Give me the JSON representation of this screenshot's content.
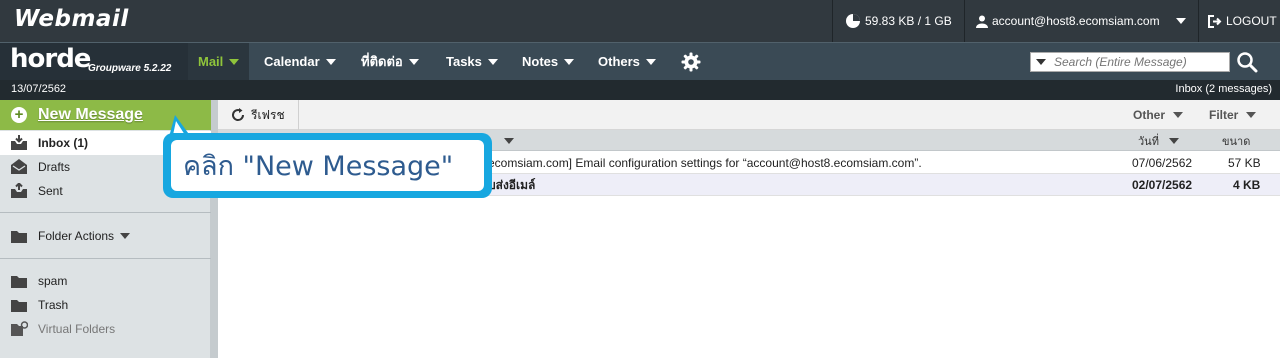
{
  "topbar": {
    "brand": "Webmail",
    "quota": "59.83 KB / 1 GB",
    "account": "account@host8.ecomsiam.com",
    "logout": "LOGOUT"
  },
  "nav": {
    "logo": "horde",
    "version": "Groupware 5.2.22",
    "items": [
      {
        "label": "Mail"
      },
      {
        "label": "Calendar"
      },
      {
        "label": "ที่ติดต่อ"
      },
      {
        "label": "Tasks"
      },
      {
        "label": "Notes"
      },
      {
        "label": "Others"
      }
    ],
    "search_placeholder": "Search (Entire Message)"
  },
  "infobar": {
    "date": "13/07/2562",
    "mailbox_status": "Inbox (2 messages)"
  },
  "sidebar": {
    "new_message": "New Message",
    "folders": [
      {
        "label": "Inbox (1)"
      },
      {
        "label": "Drafts"
      },
      {
        "label": "Sent"
      }
    ],
    "folder_actions": "Folder Actions",
    "extra_folders": [
      {
        "label": "spam"
      },
      {
        "label": "Trash"
      },
      {
        "label": "Virtual Folders"
      }
    ]
  },
  "toolbar": {
    "refresh": "รีเฟรช",
    "other": "Other",
    "filter": "Filter"
  },
  "columns": {
    "date": "วันที่",
    "size": "ขนาด"
  },
  "messages": [
    {
      "subject": "ecomsiam.com] Email configuration settings for “account@host8.ecomsiam.com”.",
      "date": "07/06/2562",
      "size": "57 KB"
    },
    {
      "subject": "บส่งอีเมล์",
      "date": "02/07/2562",
      "size": "4 KB"
    }
  ],
  "callout": {
    "text": "คลิก \"New Message\""
  },
  "colors": {
    "accent_green": "#8dba47",
    "callout_blue": "#17a7e0",
    "topbar": "#31393f"
  }
}
